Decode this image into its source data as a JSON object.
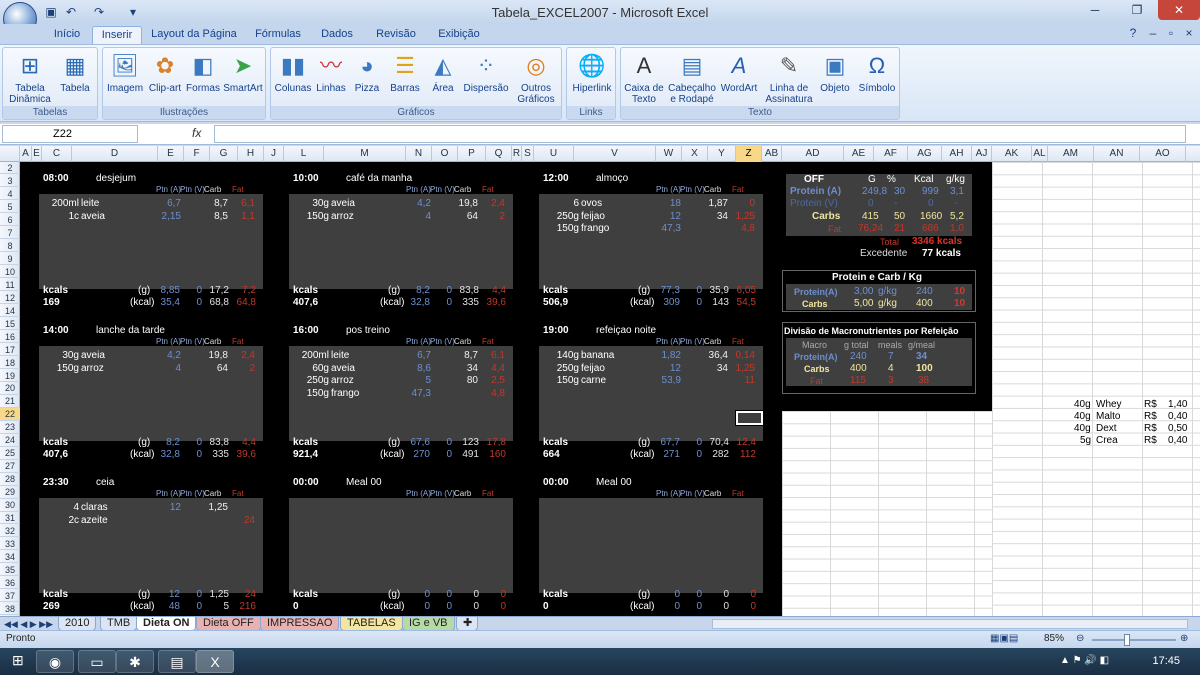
{
  "window": {
    "title": "Tabela_EXCEL2007 - Microsoft Excel"
  },
  "tabs": [
    "Início",
    "Inserir",
    "Layout da Página",
    "Fórmulas",
    "Dados",
    "Revisão",
    "Exibição"
  ],
  "active_tab": "Inserir",
  "ribbon": {
    "groups": [
      {
        "label": "Tabelas",
        "buttons": [
          "Tabela Dinâmica",
          "Tabela"
        ]
      },
      {
        "label": "Ilustrações",
        "buttons": [
          "Imagem",
          "Clip-art",
          "Formas",
          "SmartArt"
        ]
      },
      {
        "label": "Gráficos",
        "buttons": [
          "Colunas",
          "Linhas",
          "Pizza",
          "Barras",
          "Área",
          "Dispersão",
          "Outros Gráficos"
        ]
      },
      {
        "label": "Links",
        "buttons": [
          "Hiperlink"
        ]
      },
      {
        "label": "Texto",
        "buttons": [
          "Caixa de Texto",
          "Cabeçalho e Rodapé",
          "WordArt",
          "Linha de Assinatura",
          "Objeto",
          "Símbolo"
        ]
      }
    ]
  },
  "formula_bar": {
    "name_box": "Z22",
    "fx": "fx",
    "content": ""
  },
  "columns": [
    "A",
    "E",
    "C",
    "D",
    "E",
    "F",
    "G",
    "H",
    "J",
    "L",
    "M",
    "N",
    "O",
    "P",
    "Q",
    "R",
    "S",
    "U",
    "V",
    "W",
    "X",
    "Y",
    "Z",
    "AB",
    "AD",
    "AE",
    "AF",
    "AG",
    "AH",
    "AJ",
    "AK",
    "AL",
    "AM",
    "AN",
    "AO"
  ],
  "rows": [
    "2",
    "3",
    "4",
    "5",
    "6",
    "7",
    "8",
    "9",
    "10",
    "11",
    "12",
    "14",
    "15",
    "16",
    "17",
    "18",
    "19",
    "20",
    "21",
    "22",
    "23",
    "24",
    "25",
    "27",
    "28",
    "29",
    "30",
    "31",
    "32",
    "33",
    "34",
    "35",
    "36",
    "37",
    "38"
  ],
  "col_headers_meal": [
    "Ptn (A)",
    "Ptn (V)",
    "Carb",
    "Fat"
  ],
  "meals": [
    {
      "time": "08:00",
      "name": "desjejum",
      "items": [
        {
          "q": "200ml",
          "f": "leite",
          "c1": "6,7",
          "c2": "",
          "c3": "8,7",
          "c4": "6,1"
        },
        {
          "q": "1c",
          "f": "aveia",
          "c1": "2,15",
          "c2": "",
          "c3": "8,5",
          "c4": "1,1"
        }
      ],
      "g": {
        "c1": "8,85",
        "c2": "0",
        "c3": "17,2",
        "c4": "7,2"
      },
      "kcal_total": "169",
      "kcal": {
        "c1": "35,4",
        "c2": "0",
        "c3": "68,8",
        "c4": "64,8"
      }
    },
    {
      "time": "10:00",
      "name": "café da manha",
      "items": [
        {
          "q": "30g",
          "f": "aveia",
          "c1": "4,2",
          "c2": "",
          "c3": "19,8",
          "c4": "2,4"
        },
        {
          "q": "150g",
          "f": "arroz",
          "c1": "4",
          "c2": "",
          "c3": "64",
          "c4": "2"
        }
      ],
      "g": {
        "c1": "8,2",
        "c2": "0",
        "c3": "83,8",
        "c4": "4,4"
      },
      "kcal_total": "407,6",
      "kcal": {
        "c1": "32,8",
        "c2": "0",
        "c3": "335",
        "c4": "39,6"
      }
    },
    {
      "time": "12:00",
      "name": "almoço",
      "items": [
        {
          "q": "6",
          "f": "ovos",
          "c1": "18",
          "c2": "",
          "c3": "1,87",
          "c4": "0"
        },
        {
          "q": "250g",
          "f": "feijao",
          "c1": "12",
          "c2": "",
          "c3": "34",
          "c4": "1,25"
        },
        {
          "q": "150g",
          "f": "frango",
          "c1": "47,3",
          "c2": "",
          "c3": "",
          "c4": "4,8"
        }
      ],
      "g": {
        "c1": "77,3",
        "c2": "0",
        "c3": "35,9",
        "c4": "6,05"
      },
      "kcal_total": "506,9",
      "kcal": {
        "c1": "309",
        "c2": "0",
        "c3": "143",
        "c4": "54,5"
      }
    },
    {
      "time": "14:00",
      "name": "lanche da tarde",
      "items": [
        {
          "q": "30g",
          "f": "aveia",
          "c1": "4,2",
          "c2": "",
          "c3": "19,8",
          "c4": "2,4"
        },
        {
          "q": "150g",
          "f": "arroz",
          "c1": "4",
          "c2": "",
          "c3": "64",
          "c4": "2"
        }
      ],
      "g": {
        "c1": "8,2",
        "c2": "0",
        "c3": "83,8",
        "c4": "4,4"
      },
      "kcal_total": "407,6",
      "kcal": {
        "c1": "32,8",
        "c2": "0",
        "c3": "335",
        "c4": "39,6"
      }
    },
    {
      "time": "16:00",
      "name": "pos treino",
      "items": [
        {
          "q": "200ml",
          "f": "leite",
          "c1": "6,7",
          "c2": "",
          "c3": "8,7",
          "c4": "6,1"
        },
        {
          "q": "60g",
          "f": "aveia",
          "c1": "8,6",
          "c2": "",
          "c3": "34",
          "c4": "4,4"
        },
        {
          "q": "250g",
          "f": "arroz",
          "c1": "5",
          "c2": "",
          "c3": "80",
          "c4": "2,5"
        },
        {
          "q": "150g",
          "f": "frango",
          "c1": "47,3",
          "c2": "",
          "c3": "",
          "c4": "4,8"
        }
      ],
      "g": {
        "c1": "67,6",
        "c2": "0",
        "c3": "123",
        "c4": "17,8"
      },
      "kcal_total": "921,4",
      "kcal": {
        "c1": "270",
        "c2": "0",
        "c3": "491",
        "c4": "160"
      }
    },
    {
      "time": "19:00",
      "name": "refeiçao noite",
      "items": [
        {
          "q": "140g",
          "f": "banana",
          "c1": "1,82",
          "c2": "",
          "c3": "36,4",
          "c4": "0,14"
        },
        {
          "q": "250g",
          "f": "feijao",
          "c1": "12",
          "c2": "",
          "c3": "34",
          "c4": "1,25"
        },
        {
          "q": "150g",
          "f": "carne",
          "c1": "53,9",
          "c2": "",
          "c3": "",
          "c4": "11"
        }
      ],
      "g": {
        "c1": "67,7",
        "c2": "0",
        "c3": "70,4",
        "c4": "12,4"
      },
      "kcal_total": "664",
      "kcal": {
        "c1": "271",
        "c2": "0",
        "c3": "282",
        "c4": "112"
      }
    },
    {
      "time": "23:30",
      "name": "ceia",
      "items": [
        {
          "q": "4",
          "f": "claras",
          "c1": "12",
          "c2": "",
          "c3": "1,25",
          "c4": ""
        },
        {
          "q": "2c",
          "f": "azeite",
          "c1": "",
          "c2": "",
          "c3": "",
          "c4": "24"
        }
      ],
      "g": {
        "c1": "12",
        "c2": "0",
        "c3": "1,25",
        "c4": "24"
      },
      "kcal_total": "269",
      "kcal": {
        "c1": "48",
        "c2": "0",
        "c3": "5",
        "c4": "216"
      }
    },
    {
      "time": "00:00",
      "name": "Meal 00",
      "items": [],
      "g": {
        "c1": "0",
        "c2": "0",
        "c3": "0",
        "c4": "0"
      },
      "kcal_total": "0",
      "kcal": {
        "c1": "0",
        "c2": "0",
        "c3": "0",
        "c4": "0"
      }
    },
    {
      "time": "00:00",
      "name": "Meal 00",
      "items": [],
      "g": {
        "c1": "0",
        "c2": "0",
        "c3": "0",
        "c4": "0"
      },
      "kcal_total": "0",
      "kcal": {
        "c1": "0",
        "c2": "0",
        "c3": "0",
        "c4": "0"
      }
    }
  ],
  "labels": {
    "kcals": "kcals",
    "g": "(g)",
    "kcal": "(kcal)"
  },
  "summary": {
    "title": "OFF",
    "h_g": "G",
    "h_pct": "%",
    "h_kcal": "Kcal",
    "h_gkg": "g/kg",
    "rows": [
      {
        "name": "Protein (A)",
        "g": "249,8",
        "pct": "30",
        "kcal": "999",
        "gkg": "3,1"
      },
      {
        "name": "Protein (V)",
        "g": "0",
        "pct": "-",
        "kcal": "0",
        "gkg": "-"
      },
      {
        "name": "Carbs",
        "g": "415",
        "pct": "50",
        "kcal": "1660",
        "gkg": "5,2"
      },
      {
        "name": "Fat",
        "g": "76,24",
        "pct": "21",
        "kcal": "686",
        "gkg": "1,0"
      }
    ],
    "total_label": "Total",
    "total": "3346 kcals",
    "exc_label": "Excedente",
    "exc": "77 kcals"
  },
  "pcb": {
    "title": "Protein e Carb / Kg",
    "rows": [
      {
        "name": "Protein(A)",
        "v": "3,00",
        "u": "g/kg",
        "n": "240",
        "r": "10"
      },
      {
        "name": "Carbs",
        "v": "5,00",
        "u": "g/kg",
        "n": "400",
        "r": "10"
      }
    ]
  },
  "div": {
    "title": "Divisão de Macronutrientes por Refeição",
    "h": [
      "Macro",
      "g total",
      "meals",
      "g/meal"
    ],
    "rows": [
      {
        "name": "Protein(A)",
        "a": "240",
        "b": "7",
        "c": "34"
      },
      {
        "name": "Carbs",
        "a": "400",
        "b": "4",
        "c": "100"
      },
      {
        "name": "Fat",
        "a": "115",
        "b": "3",
        "c": "38"
      }
    ]
  },
  "side": [
    {
      "q": "40g",
      "n": "Whey",
      "r": "R$",
      "p": "1,40"
    },
    {
      "q": "40g",
      "n": "Malto",
      "r": "R$",
      "p": "0,40"
    },
    {
      "q": "40g",
      "n": "Dext",
      "r": "R$",
      "p": "0,50"
    },
    {
      "q": "5g",
      "n": "Crea",
      "r": "R$",
      "p": "0,40"
    }
  ],
  "sheet_tabs": [
    "2010",
    "TMB",
    "Dieta ON",
    "Dieta OFF",
    "IMPRESSAO",
    "TABELAS",
    "IG e VB"
  ],
  "active_sheet": "Dieta ON",
  "status": {
    "ready": "Pronto",
    "zoom": "85%"
  },
  "clock": "17:45"
}
